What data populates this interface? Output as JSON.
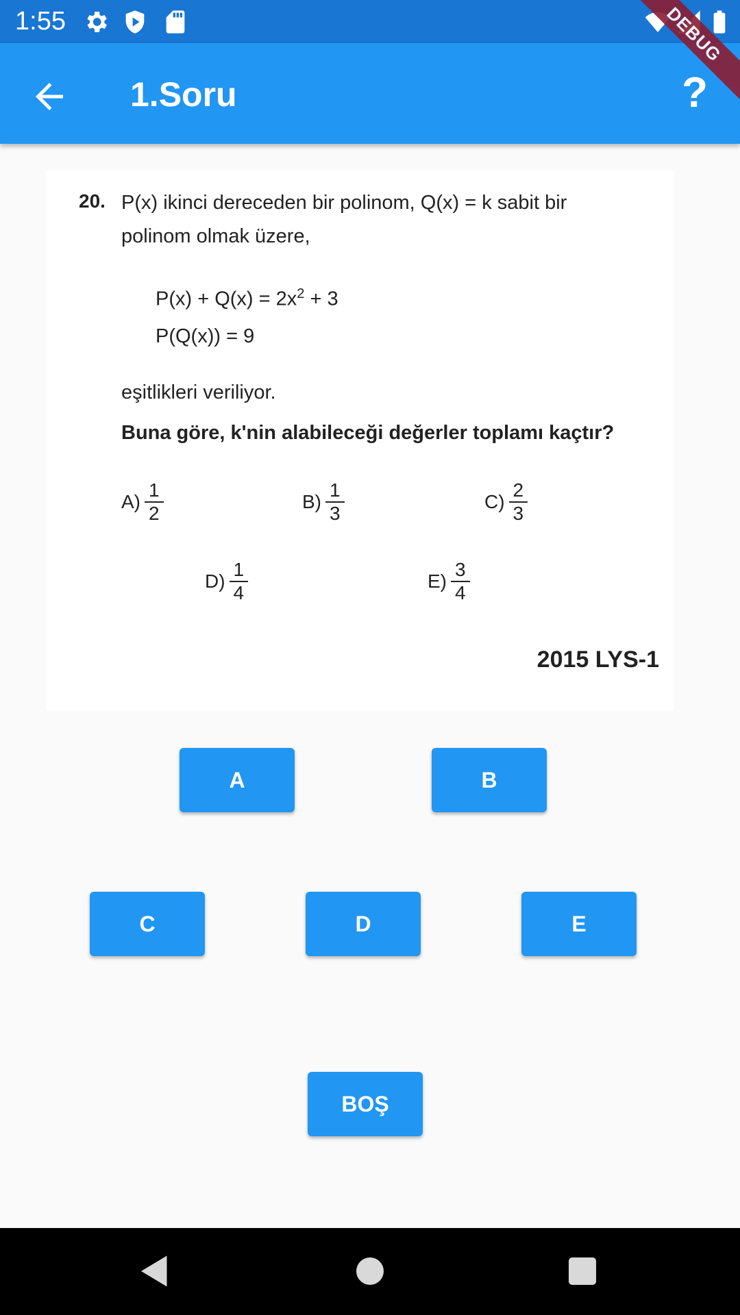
{
  "status_bar": {
    "time": "1:55",
    "icons": [
      "gear-icon",
      "play-protect-icon",
      "sd-card-icon",
      "wifi-icon",
      "signal-icon",
      "battery-icon"
    ]
  },
  "debug_banner": "DEBUG",
  "app_bar": {
    "title": "1.Soru",
    "back_icon": "arrow-back-icon",
    "help_label": "?"
  },
  "question": {
    "number": "20.",
    "line1": "P(x) ikinci dereceden bir polinom,  Q(x) = k  sabit bir",
    "line2": "polinom olmak üzere,",
    "formula1_prefix": "P(x) + Q(x) = 2x",
    "formula1_exp": "2",
    "formula1_suffix": " + 3",
    "formula2": "P(Q(x)) = 9",
    "line3": "eşitlikleri veriliyor.",
    "prompt": "Buna göre, k'nin alabileceği değerler toplamı kaçtır?",
    "choices": [
      {
        "label": "A)",
        "num": "1",
        "den": "2"
      },
      {
        "label": "B)",
        "num": "1",
        "den": "3"
      },
      {
        "label": "C)",
        "num": "2",
        "den": "3"
      },
      {
        "label": "D)",
        "num": "1",
        "den": "4"
      },
      {
        "label": "E)",
        "num": "3",
        "den": "4"
      }
    ],
    "source": "2015 LYS-1"
  },
  "answers": {
    "a": "A",
    "b": "B",
    "c": "C",
    "d": "D",
    "e": "E",
    "blank": "BOŞ"
  },
  "nav": [
    "back-triangle-icon",
    "home-circle-icon",
    "recents-square-icon"
  ],
  "colors": {
    "status_bar": "#1976d2",
    "app_bar": "#2196f3",
    "button": "#2196f3",
    "background": "#fafafa"
  }
}
